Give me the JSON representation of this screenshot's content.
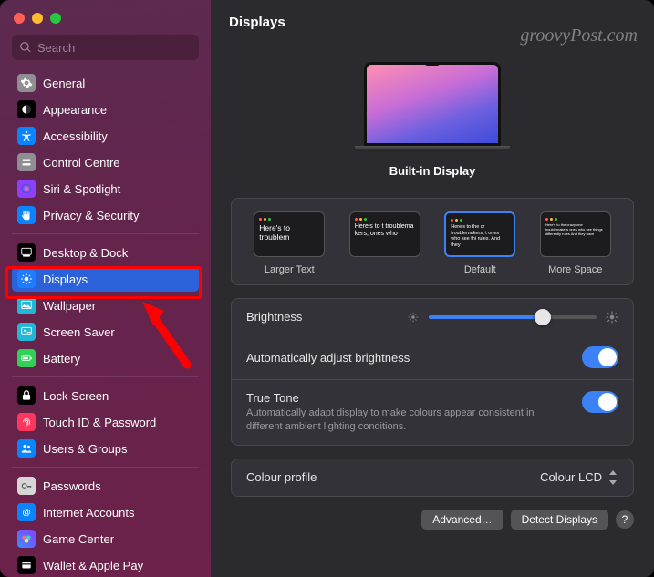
{
  "watermark": "groovyPost.com",
  "search": {
    "placeholder": "Search"
  },
  "sidebar_groups": [
    [
      {
        "id": "general",
        "label": "General",
        "icon": "gear-icon",
        "bg": "ic-gray"
      },
      {
        "id": "appearance",
        "label": "Appearance",
        "icon": "appearance-icon",
        "bg": "ic-black"
      },
      {
        "id": "accessibility",
        "label": "Accessibility",
        "icon": "accessibility-icon",
        "bg": "ic-blue"
      },
      {
        "id": "control-centre",
        "label": "Control Centre",
        "icon": "control-centre-icon",
        "bg": "ic-gray"
      },
      {
        "id": "siri",
        "label": "Siri & Spotlight",
        "icon": "siri-icon",
        "bg": "ic-purple"
      },
      {
        "id": "privacy",
        "label": "Privacy & Security",
        "icon": "hand-icon",
        "bg": "ic-blue"
      }
    ],
    [
      {
        "id": "desktop-dock",
        "label": "Desktop & Dock",
        "icon": "dock-icon",
        "bg": "ic-black"
      },
      {
        "id": "displays",
        "label": "Displays",
        "icon": "brightness-icon",
        "bg": "ic-brt",
        "selected": true
      },
      {
        "id": "wallpaper",
        "label": "Wallpaper",
        "icon": "wallpaper-icon",
        "bg": "ic-cyan"
      },
      {
        "id": "screen-saver",
        "label": "Screen Saver",
        "icon": "screensaver-icon",
        "bg": "ic-cyan"
      },
      {
        "id": "battery",
        "label": "Battery",
        "icon": "battery-icon",
        "bg": "ic-green"
      }
    ],
    [
      {
        "id": "lock-screen",
        "label": "Lock Screen",
        "icon": "lock-icon",
        "bg": "ic-black"
      },
      {
        "id": "touch-id",
        "label": "Touch ID & Password",
        "icon": "fingerprint-icon",
        "bg": "ic-red"
      },
      {
        "id": "users-groups",
        "label": "Users & Groups",
        "icon": "users-icon",
        "bg": "ic-blue"
      }
    ],
    [
      {
        "id": "passwords",
        "label": "Passwords",
        "icon": "key-icon",
        "bg": "ic-keys"
      },
      {
        "id": "internet-accounts",
        "label": "Internet Accounts",
        "icon": "at-icon",
        "bg": "ic-blue"
      },
      {
        "id": "game-center",
        "label": "Game Center",
        "icon": "game-center-icon",
        "bg": "ic-col"
      },
      {
        "id": "wallet",
        "label": "Wallet & Apple Pay",
        "icon": "wallet-icon",
        "bg": "ic-black"
      }
    ]
  ],
  "title": "Displays",
  "hero": {
    "label": "Built-in Display"
  },
  "resolution": {
    "options": [
      {
        "label": "Larger Text",
        "sample": "Here's to troublem",
        "selected": false
      },
      {
        "label": "",
        "sample": "Here's to t troublema kers, ones who",
        "selected": false
      },
      {
        "label": "Default",
        "sample": "Here's to the cr troublemakers, t ones who see thi rules. And they",
        "selected": true
      },
      {
        "label": "More Space",
        "sample": "Here's to the crazy one troublemakers ones who see things differently rules And they have",
        "selected": false
      }
    ]
  },
  "rows": {
    "brightness": {
      "label": "Brightness",
      "value": 68
    },
    "auto_brightness": {
      "label": "Automatically adjust brightness",
      "on": true
    },
    "true_tone": {
      "label": "True Tone",
      "desc": "Automatically adapt display to make colours appear consistent in different ambient lighting conditions.",
      "on": true
    },
    "colour_profile": {
      "label": "Colour profile",
      "value": "Colour LCD"
    }
  },
  "buttons": {
    "advanced": "Advanced…",
    "detect": "Detect Displays",
    "help": "?"
  }
}
